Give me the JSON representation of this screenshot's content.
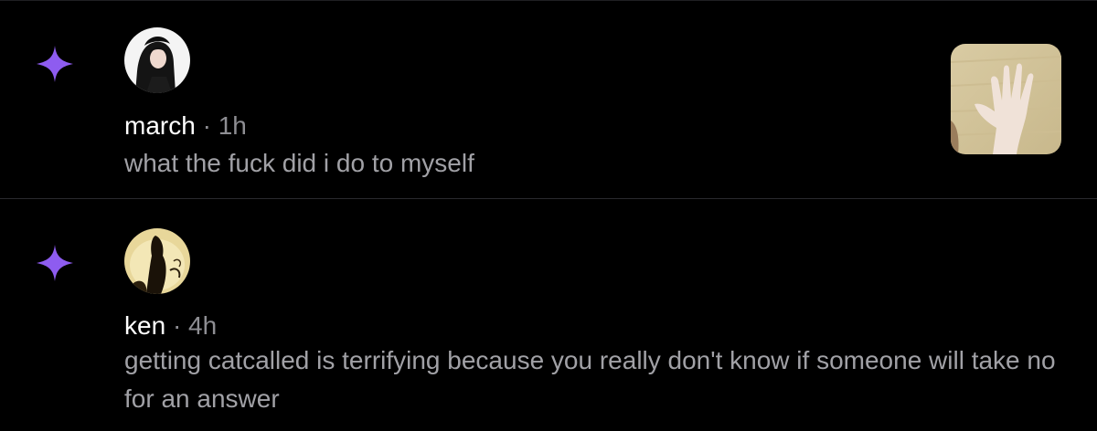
{
  "notifications": [
    {
      "username": "march",
      "separator": "·",
      "time": "1h",
      "text": "what the fuck did i do to myself",
      "badge_icon": "sparkle-icon",
      "has_thumbnail": true
    },
    {
      "username": "ken",
      "separator": "·",
      "time": "4h",
      "text": "getting catcalled is terrifying because you really don't know if someone will take no for an answer",
      "badge_icon": "sparkle-icon",
      "has_thumbnail": false
    }
  ],
  "colors": {
    "background": "#000000",
    "accent_sparkle": "#8e5cf0",
    "username": "#ffffff",
    "meta_gray": "#8e8e93",
    "body_gray": "#a1a1a6",
    "divider": "#2a2a2e"
  }
}
